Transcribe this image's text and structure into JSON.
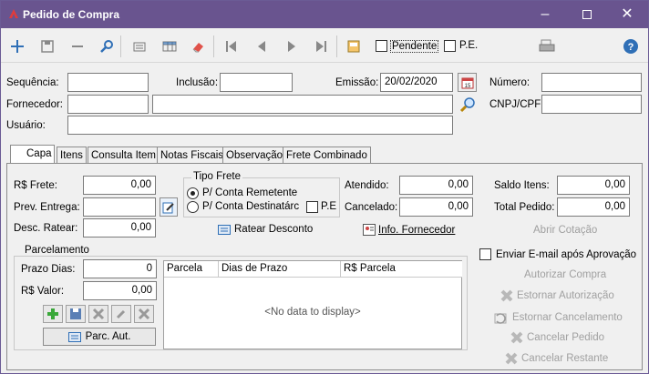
{
  "window": {
    "title": "Pedido de Compra"
  },
  "toolbar": {
    "pendente_label": "Pendente",
    "pe_label": "P.E."
  },
  "header": {
    "sequencia_label": "Sequência:",
    "sequencia_value": "",
    "inclusao_label": "Inclusão:",
    "inclusao_value": "",
    "emissao_label": "Emissão:",
    "emissao_value": "20/02/2020",
    "numero_label": "Número:",
    "numero_value": "",
    "fornecedor_label": "Fornecedor:",
    "fornecedor_code": "",
    "fornecedor_name": "",
    "cnpj_label": "CNPJ/CPF:",
    "cnpj_value": "",
    "usuario_label": "Usuário:",
    "usuario_value": ""
  },
  "tabs": [
    "Capa",
    "Itens",
    "Consulta Item",
    "Notas Fiscais",
    "Observação",
    "Frete Combinado"
  ],
  "capa": {
    "frete_label": "R$ Frete:",
    "frete_value": "0,00",
    "prev_entrega_label": "Prev. Entrega:",
    "prev_entrega_value": "",
    "desc_ratear_label": "Desc. Ratear:",
    "desc_ratear_value": "0,00",
    "tipo_frete_label": "Tipo Frete",
    "radio_remetente": "P/ Conta Remetente",
    "radio_destinatario": "P/ Conta Destinatárc",
    "pe_label": "P.E",
    "atendido_label": "Atendido:",
    "atendido_value": "0,00",
    "cancelado_label": "Cancelado:",
    "cancelado_value": "0,00",
    "saldo_itens_label": "Saldo Itens:",
    "saldo_itens_value": "0,00",
    "total_pedido_label": "Total Pedido:",
    "total_pedido_value": "0,00",
    "ratear_desconto_label": "Ratear Desconto",
    "info_fornecedor_label": "Info. Fornecedor",
    "abrir_cotacao_label": "Abrir Cotação",
    "enviar_email_label": "Enviar E-mail após Aprovação",
    "autorizar_compra_label": "Autorizar Compra",
    "estornar_autorizacao_label": "Estornar Autorização",
    "estornar_cancelamento_label": "Estornar Cancelamento",
    "cancelar_pedido_label": "Cancelar Pedido",
    "cancelar_restante_label": "Cancelar Restante"
  },
  "parcelamento": {
    "label": "Parcelamento",
    "prazo_dias_label": "Prazo Dias:",
    "prazo_dias_value": "0",
    "valor_label": "R$ Valor:",
    "valor_value": "0,00",
    "parc_aut_label": "Parc. Aut.",
    "columns": [
      "Parcela",
      "Dias de Prazo",
      "R$ Parcela"
    ],
    "empty_text": "<No data to display>"
  }
}
